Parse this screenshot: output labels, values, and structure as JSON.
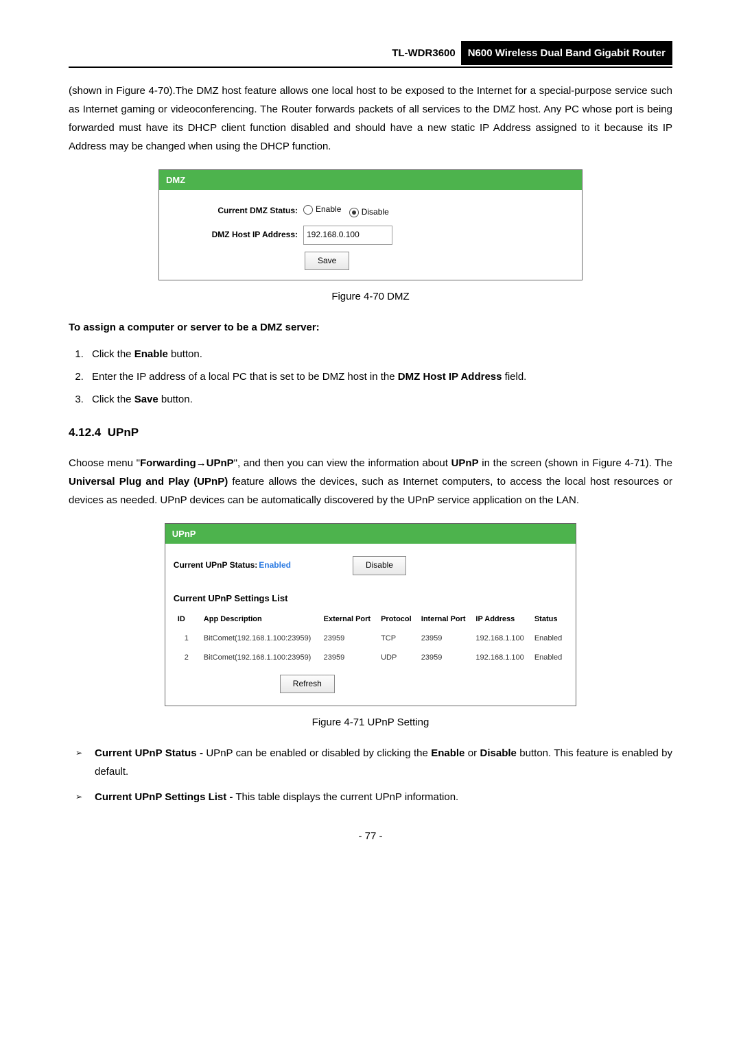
{
  "header": {
    "model": "TL-WDR3600",
    "product": "N600 Wireless Dual Band Gigabit Router"
  },
  "para1": "(shown in Figure 4-70).The DMZ host feature allows one local host to be exposed to the Internet for a special-purpose service such as Internet gaming or videoconferencing. The Router forwards packets of all services to the DMZ host. Any PC whose port is being forwarded must have its DHCP client function disabled and should have a new static IP Address assigned to it because its IP Address may be changed when using the DHCP function.",
  "dmz": {
    "panel_title": "DMZ",
    "status_label": "Current DMZ Status:",
    "enable_label": "Enable",
    "disable_label": "Disable",
    "host_label": "DMZ Host IP Address:",
    "host_value": "192.168.0.100",
    "save_btn": "Save"
  },
  "fig70": "Figure 4-70 DMZ",
  "assign_bold": "To assign a computer or server to be a DMZ server:",
  "steps": {
    "s1_pre": "Click the ",
    "s1_bold": "Enable",
    "s1_post": " button.",
    "s2_pre": "Enter the IP address of a local PC that is set to be DMZ host in the ",
    "s2_bold": "DMZ Host IP Address",
    "s2_post": " field.",
    "s3_pre": "Click the ",
    "s3_bold": "Save",
    "s3_post": " button."
  },
  "section_num": "4.12.4",
  "section_title": "UPnP",
  "para2_a": "Choose menu \"",
  "para2_b": "Forwarding",
  "para2_c": "→",
  "para2_d": "UPnP",
  "para2_e": "\", and then you can view the information about ",
  "para2_f": "UPnP",
  "para2_g": " in the screen (shown in Figure 4-71). The ",
  "para2_h": "Universal Plug and Play (UPnP)",
  "para2_i": " feature allows the devices, such as Internet computers, to access the local host resources or devices as needed. UPnP devices can be automatically discovered by the UPnP service application on the LAN.",
  "upnp": {
    "panel_title": "UPnP",
    "status_label": "Current UPnP Status:",
    "status_value": "Enabled",
    "disable_btn": "Disable",
    "list_title": "Current UPnP Settings List",
    "headers": {
      "id": "ID",
      "app": "App Description",
      "ext": "External Port",
      "proto": "Protocol",
      "int": "Internal Port",
      "ip": "IP Address",
      "status": "Status"
    },
    "rows": [
      {
        "id": "1",
        "app": "BitComet(192.168.1.100:23959)",
        "ext": "23959",
        "proto": "TCP",
        "int": "23959",
        "ip": "192.168.1.100",
        "status": "Enabled"
      },
      {
        "id": "2",
        "app": "BitComet(192.168.1.100:23959)",
        "ext": "23959",
        "proto": "UDP",
        "int": "23959",
        "ip": "192.168.1.100",
        "status": "Enabled"
      }
    ],
    "refresh_btn": "Refresh"
  },
  "fig71": "Figure 4-71 UPnP Setting",
  "bullet1_a": "Current UPnP Status -",
  "bullet1_b": " UPnP can be enabled or disabled by clicking the ",
  "bullet1_c": "Enable",
  "bullet1_d": " or ",
  "bullet1_e": "Disable",
  "bullet1_f": " button. This feature is enabled by default.",
  "bullet2_a": "Current UPnP Settings List -",
  "bullet2_b": " This table displays the current UPnP information.",
  "page_num": "- 77 -"
}
